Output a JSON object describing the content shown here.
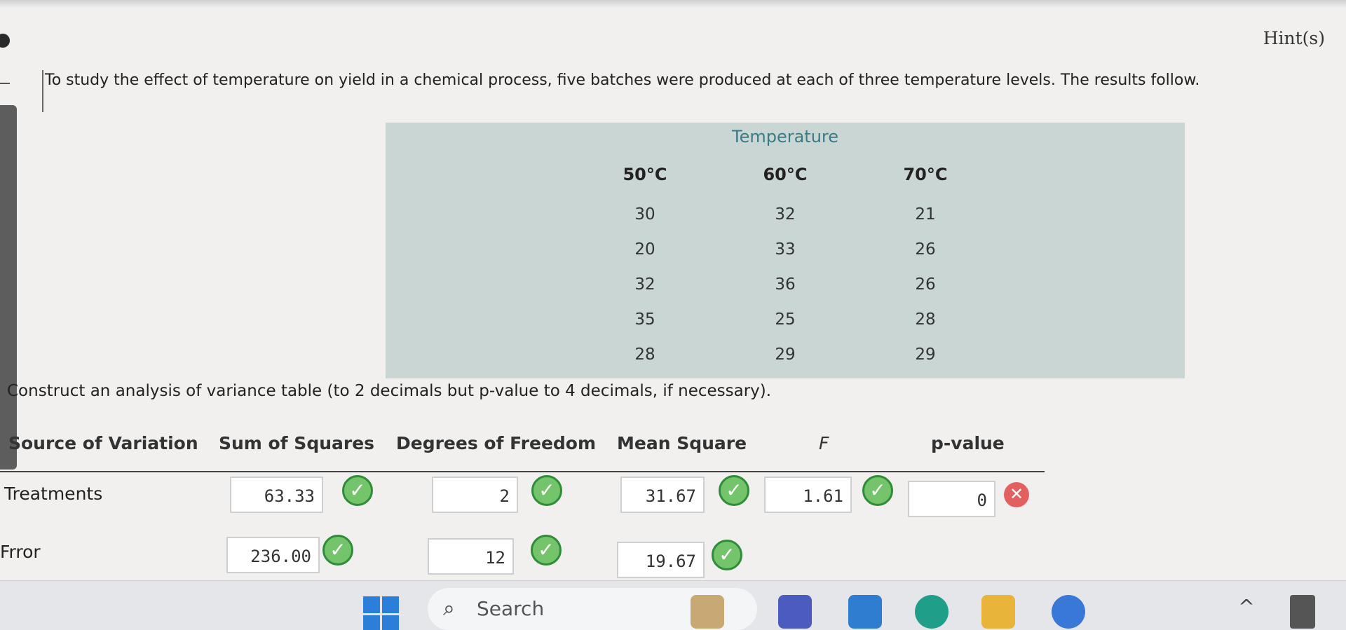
{
  "hint": {
    "label": "Hint(s)"
  },
  "question": {
    "text": "To study the effect of temperature on yield in a chemical process, five batches were produced at each of three temperature levels. The results follow."
  },
  "data_table": {
    "group_header": "Temperature",
    "columns": [
      {
        "label": "50°C",
        "values": [
          "30",
          "20",
          "32",
          "35",
          "28"
        ]
      },
      {
        "label": "60°C",
        "values": [
          "32",
          "33",
          "36",
          "25",
          "29"
        ]
      },
      {
        "label": "70°C",
        "values": [
          "21",
          "26",
          "26",
          "28",
          "29"
        ]
      }
    ]
  },
  "instruction": "Construct an analysis of variance table (to 2 decimals but p-value to 4 decimals, if necessary).",
  "anova": {
    "headers": {
      "source": "Source of Variation",
      "ss": "Sum of Squares",
      "df": "Degrees of Freedom",
      "ms": "Mean Square",
      "f": "F",
      "p": "p-value"
    },
    "rows": [
      {
        "label": "Treatments",
        "ss": "63.33",
        "df": "2",
        "ms": "31.67",
        "f": "1.61",
        "p": "0"
      },
      {
        "label": "Frror",
        "ss": "236.00",
        "df": "12",
        "ms": "19.67"
      }
    ]
  },
  "taskbar": {
    "search_label": "Search"
  },
  "colors": {
    "panel": "#c9d6d3",
    "accent_header": "#3b7b86",
    "correct": "#73c46a",
    "wrong": "#e26060"
  }
}
